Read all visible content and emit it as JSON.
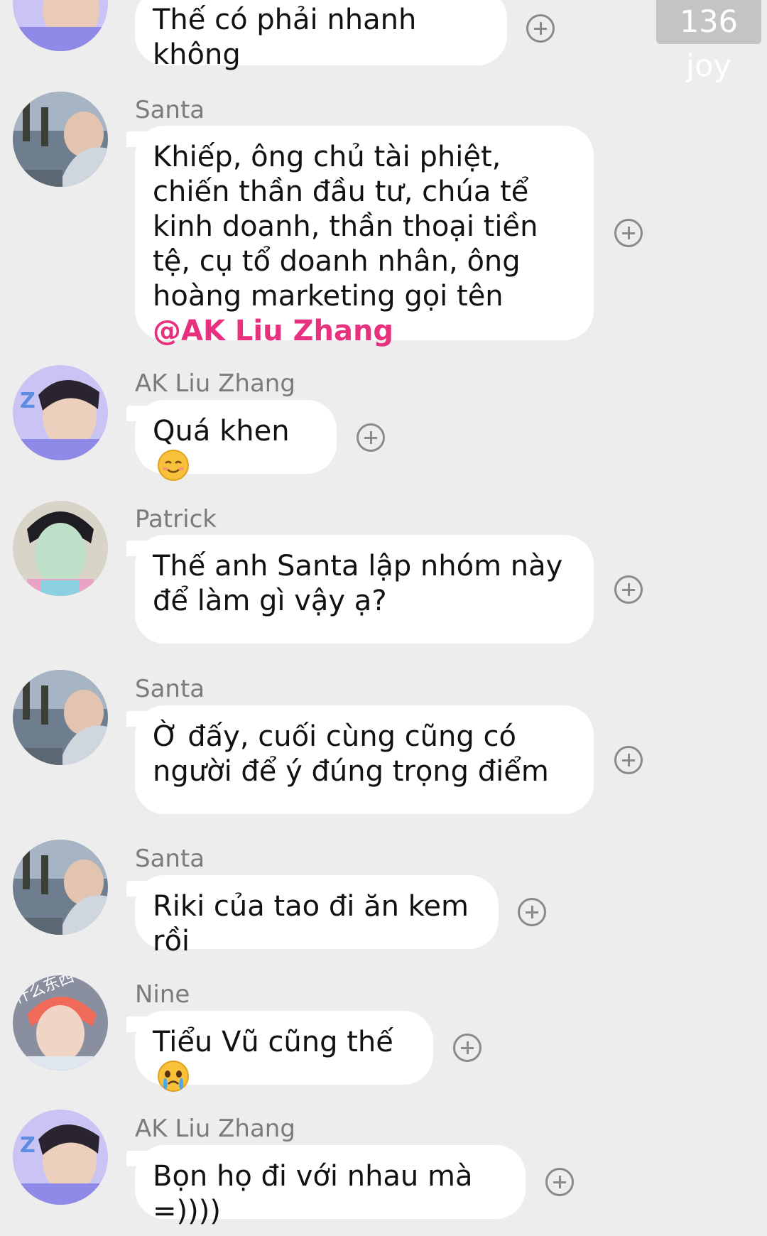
{
  "watermark": "136 joy",
  "messages": [
    {
      "sender": "",
      "text": "Thế có phải nhanh không",
      "avatar": "ak-avatar"
    },
    {
      "sender": "Santa",
      "text": "Khiếp, ông chủ tài phiệt, chiến thần đầu tư, chúa tể kinh doanh, thần thoại tiền tệ, cụ tổ doanh nhân, ông hoàng marketing gọi tên ",
      "mention": "@AK Liu Zhang",
      "avatar": "santa-avatar"
    },
    {
      "sender": "AK Liu Zhang",
      "text": "Quá khen ",
      "emoji": "smiling-face-emoji",
      "avatar": "ak-avatar"
    },
    {
      "sender": "Patrick",
      "text": "Thế anh Santa lập nhóm này để làm gì vậy ạ?",
      "avatar": "patrick-avatar"
    },
    {
      "sender": "Santa",
      "text": "Ờ đấy, cuối cùng cũng có người để ý đúng trọng điểm",
      "avatar": "santa-avatar"
    },
    {
      "sender": "Santa",
      "text": "Riki của tao đi ăn kem rồi",
      "avatar": "santa-avatar"
    },
    {
      "sender": "Nine",
      "text": "Tiểu Vũ cũng thế ",
      "emoji": "crying-face-emoji",
      "avatar": "nine-avatar",
      "avatar_caption": "什么东西"
    },
    {
      "sender": "AK Liu Zhang",
      "text": "Bọn họ đi với nhau mà =))))",
      "avatar": "ak-avatar"
    }
  ],
  "add_reaction_icon": "plus-circle-icon",
  "colors": {
    "background": "#ededed",
    "bubble": "#ffffff",
    "mention": "#e8317e",
    "sender": "#7b7b7b"
  }
}
